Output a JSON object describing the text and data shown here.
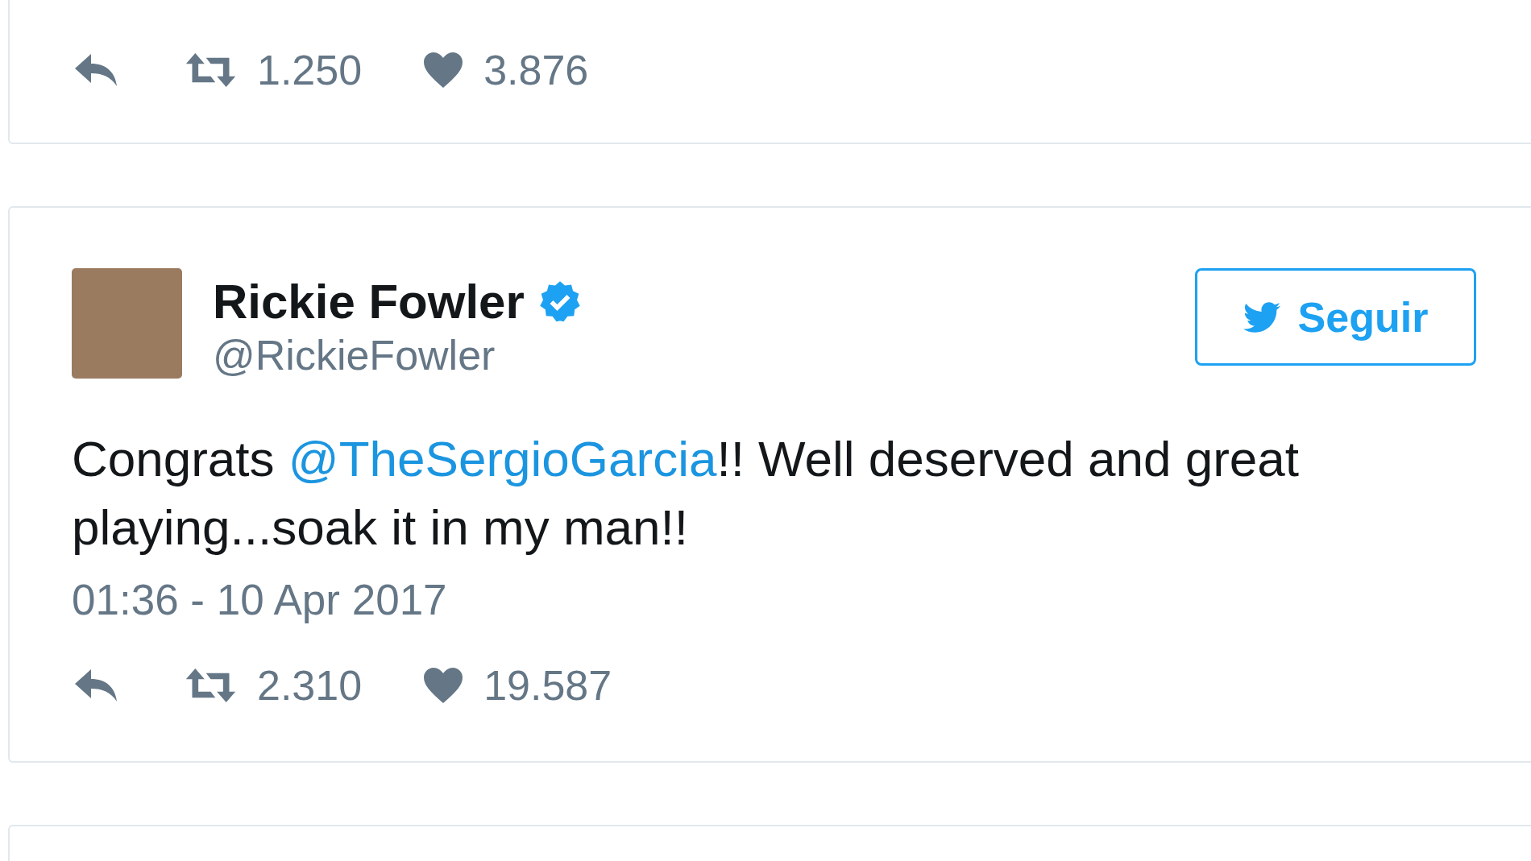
{
  "tweets": [
    {
      "cut": true,
      "retweets": "1.250",
      "likes": "3.876"
    },
    {
      "cut": false,
      "name": "Rickie Fowler",
      "verified": true,
      "handle": "@RickieFowler",
      "follow_label": "Seguir",
      "text_parts": [
        {
          "kind": "text",
          "text": "Congrats "
        },
        {
          "kind": "mention",
          "text": "@TheSergioGarcia"
        },
        {
          "kind": "text",
          "text": "!! Well deserved and great playing...soak it in my man!!"
        }
      ],
      "timestamp": "01:36 - 10 Apr 2017",
      "retweets": "2.310",
      "likes": "19.587"
    }
  ]
}
